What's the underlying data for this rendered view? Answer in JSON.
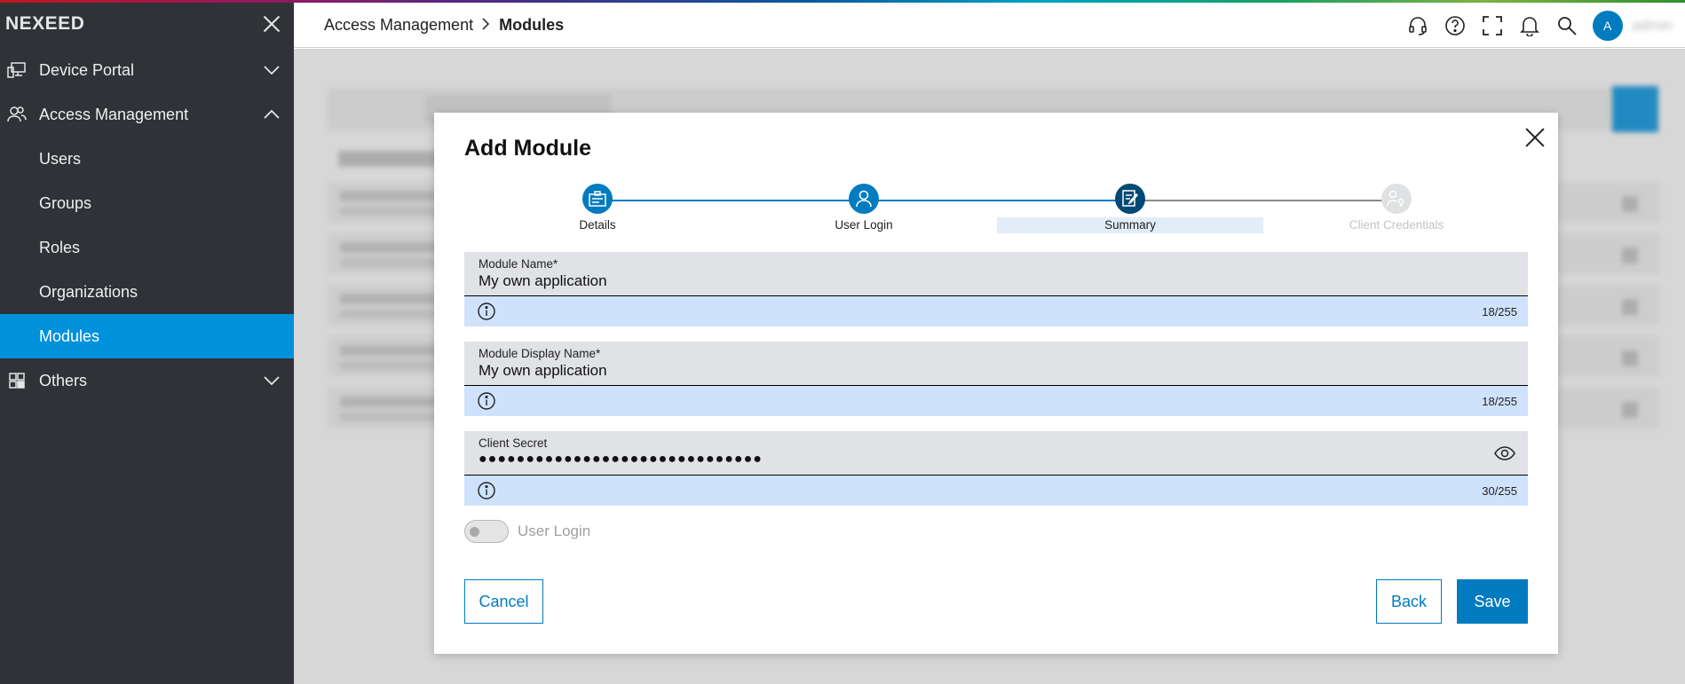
{
  "app": {
    "brand": "NEXEED"
  },
  "sidebar": {
    "items": [
      {
        "label": "Device Portal",
        "icon": "device-portal-icon",
        "expanded": false
      },
      {
        "label": "Access Management",
        "icon": "people-icon",
        "expanded": true
      },
      {
        "label": "Others",
        "icon": "grid-icon",
        "expanded": false
      }
    ],
    "subitems": [
      {
        "label": "Users"
      },
      {
        "label": "Groups"
      },
      {
        "label": "Roles"
      },
      {
        "label": "Organizations"
      },
      {
        "label": "Modules",
        "active": true
      }
    ]
  },
  "header": {
    "breadcrumb": {
      "parent": "Access Management",
      "current": "Modules"
    },
    "avatar_initial": "A",
    "username": "admin",
    "icons": [
      "headset-icon",
      "help-icon",
      "fullscreen-icon",
      "bell-icon",
      "search-icon"
    ]
  },
  "modal": {
    "title": "Add Module",
    "steps": [
      {
        "label": "Details",
        "state": "done"
      },
      {
        "label": "User Login",
        "state": "done"
      },
      {
        "label": "Summary",
        "state": "current"
      },
      {
        "label": "Client Credentials",
        "state": "disabled"
      }
    ],
    "fields": {
      "module_name": {
        "label": "Module Name*",
        "value": "My own application",
        "counter": "18/255"
      },
      "display_name": {
        "label": "Module Display Name*",
        "value": "My own application",
        "counter": "18/255"
      },
      "client_secret": {
        "label": "Client Secret",
        "value": "●●●●●●●●●●●●●●●●●●●●●●●●●●●●●●",
        "counter": "30/255"
      }
    },
    "toggle": {
      "label": "User Login",
      "on": false
    },
    "buttons": {
      "cancel": "Cancel",
      "back": "Back",
      "save": "Save"
    }
  },
  "colors": {
    "sidebar_bg": "#2f3237",
    "active_item": "#0091dc",
    "primary": "#007bc0",
    "step_done": "#007bc0",
    "step_current": "#004975",
    "step_disabled": "#dfe1e3",
    "helper_bg": "#cfe2fb",
    "field_bg": "#e0e2e5"
  }
}
